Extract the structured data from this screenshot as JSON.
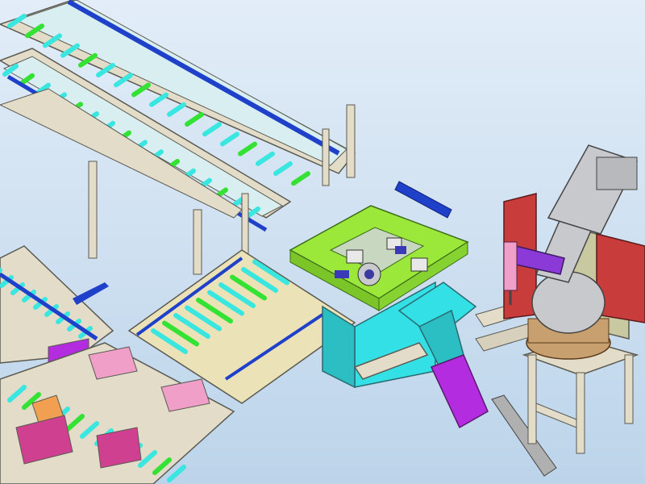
{
  "scene": {
    "description_visible_text": [],
    "colors": {
      "background_top": "#e2edf8",
      "background_bottom": "#bcd4ea",
      "frame_beige": "#e2dcc8",
      "frame_edge": "#5b5a52",
      "roller_cyan": "#39e6e0",
      "roller_green": "#33e233",
      "guide_blue": "#1f40c8",
      "station_lime": "#9be83a",
      "cabinet_cyan": "#33e0e6",
      "hopper_magenta": "#b42ce0",
      "robot_grey": "#c8c9cc",
      "robot_base_tan": "#c8a070",
      "panel_red": "#c83c3c",
      "tool_purple": "#8b3ad8",
      "accent_pink": "#f0a0c8",
      "accent_orange": "#f0a050"
    },
    "icons": [
      "robot-arm-icon",
      "hopper-icon",
      "roller-conveyor-icon",
      "control-panel-icon"
    ]
  }
}
